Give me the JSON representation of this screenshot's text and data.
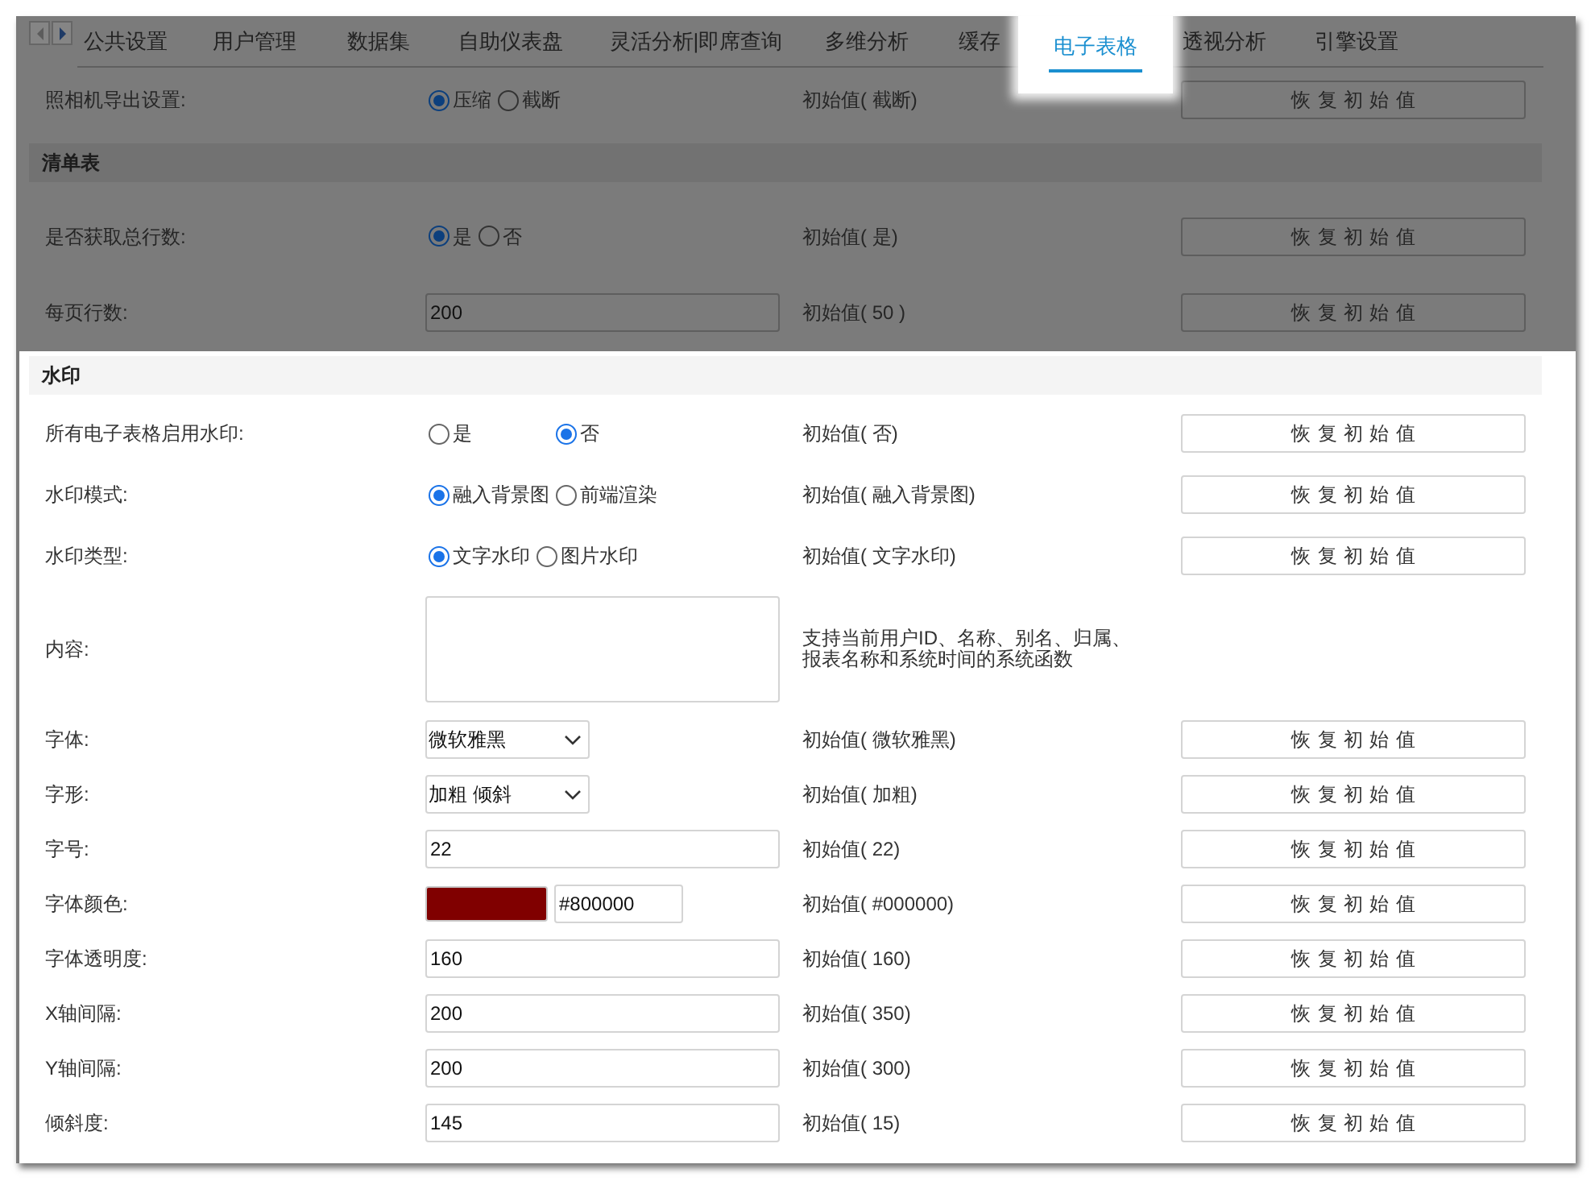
{
  "tabs": [
    {
      "label": "公共设置",
      "selected": false
    },
    {
      "label": "用户管理",
      "selected": false
    },
    {
      "label": "数据集",
      "selected": false
    },
    {
      "label": "自助仪表盘",
      "selected": false
    },
    {
      "label": "灵活分析|即席查询",
      "selected": false
    },
    {
      "label": "多维分析",
      "selected": false
    },
    {
      "label": "缓存",
      "selected": false
    },
    {
      "label": "电子表格",
      "selected": true
    },
    {
      "label": "透视分析",
      "selected": false
    },
    {
      "label": "引擎设置",
      "selected": false
    }
  ],
  "sections": [
    {
      "dimmed": true,
      "rows": [
        {
          "kind": "radio",
          "label": "照相机导出设置:",
          "options": [
            {
              "label": "压缩",
              "selected": true
            },
            {
              "label": "截断",
              "selected": false
            }
          ],
          "initial": "初始值( 截断)",
          "reset": "恢复初始值"
        }
      ]
    },
    {
      "title": "清单表",
      "dimmed": true,
      "rows": [
        {
          "kind": "radio",
          "label": "是否获取总行数:",
          "options": [
            {
              "label": "是",
              "selected": true
            },
            {
              "label": "否",
              "selected": false
            }
          ],
          "initial": "初始值( 是)",
          "reset": "恢复初始值"
        },
        {
          "kind": "text",
          "label": "每页行数:",
          "value": "200",
          "initial": "初始值( 50 )",
          "reset": "恢复初始值"
        }
      ]
    },
    {
      "title": "水印",
      "dimmed": false,
      "rows": [
        {
          "kind": "radio_spaced",
          "label": "所有电子表格启用水印:",
          "options": [
            {
              "label": "是",
              "selected": false
            },
            {
              "label": "否",
              "selected": true
            }
          ],
          "initial": "初始值( 否)",
          "reset": "恢复初始值"
        },
        {
          "kind": "radio",
          "label": "水印模式:",
          "options": [
            {
              "label": "融入背景图",
              "selected": true
            },
            {
              "label": "前端渲染",
              "selected": false
            }
          ],
          "initial": "初始值( 融入背景图)",
          "reset": "恢复初始值"
        },
        {
          "kind": "radio",
          "label": "水印类型:",
          "options": [
            {
              "label": "文字水印",
              "selected": true
            },
            {
              "label": "图片水印",
              "selected": false
            }
          ],
          "initial": "初始值( 文字水印)",
          "reset": "恢复初始值"
        },
        {
          "kind": "textarea",
          "label": "内容:",
          "note": "支持当前用户ID、名称、别名、归属、报表名称和系统时间的系统函数"
        },
        {
          "kind": "select",
          "label": "字体:",
          "value": "微软雅黑",
          "initial": "初始值( 微软雅黑)",
          "reset": "恢复初始值"
        },
        {
          "kind": "select",
          "label": "字形:",
          "value": "加粗 倾斜",
          "initial": "初始值( 加粗)",
          "reset": "恢复初始值"
        },
        {
          "kind": "text",
          "label": "字号:",
          "value": "22",
          "initial": "初始值( 22)",
          "reset": "恢复初始值"
        },
        {
          "kind": "color",
          "label": "字体颜色:",
          "color": "#800000",
          "value": "#800000",
          "initial": "初始值( #000000)",
          "reset": "恢复初始值"
        },
        {
          "kind": "text",
          "label": "字体透明度:",
          "value": "160",
          "initial": "初始值( 160)",
          "reset": "恢复初始值"
        },
        {
          "kind": "text",
          "label": "X轴间隔:",
          "value": "200",
          "initial": "初始值( 350)",
          "reset": "恢复初始值"
        },
        {
          "kind": "text",
          "label": "Y轴间隔:",
          "value": "200",
          "initial": "初始值( 300)",
          "reset": "恢复初始值"
        },
        {
          "kind": "text",
          "label": "倾斜度:",
          "value": "145",
          "initial": "初始值( 15)",
          "reset": "恢复初始值"
        }
      ]
    }
  ]
}
